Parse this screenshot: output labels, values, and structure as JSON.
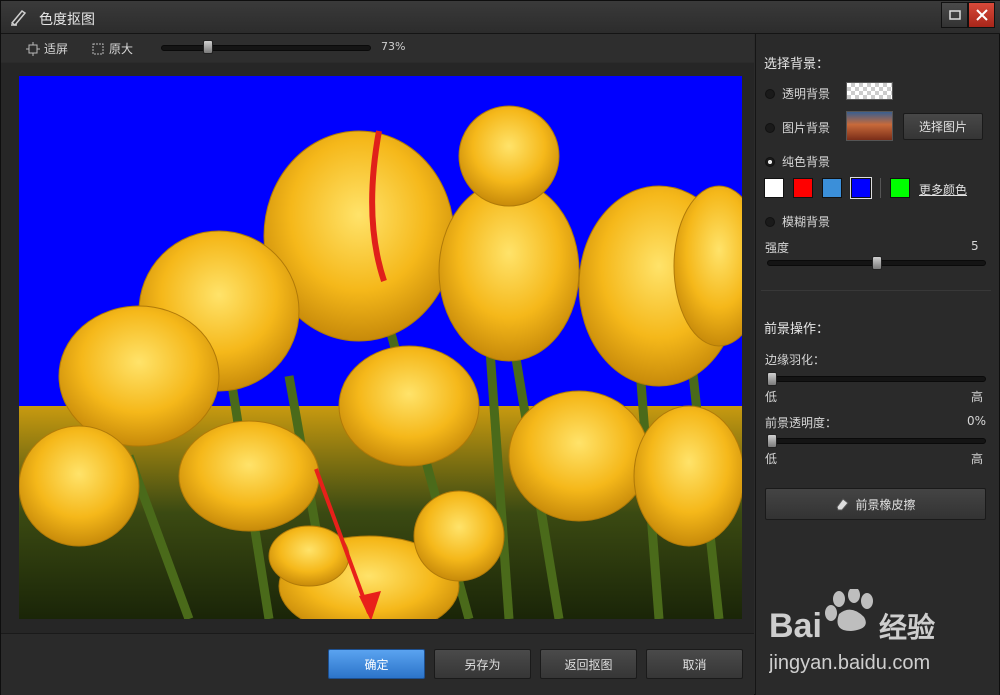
{
  "window": {
    "title": "色度抠图",
    "buttons": {
      "maximize_icon": "maximize-icon",
      "close_icon": "close-icon"
    }
  },
  "toolbar": {
    "fit_label": "适屏",
    "original_label": "原大",
    "zoom": {
      "value_label": "73%",
      "value": 0.73
    }
  },
  "canvas": {
    "background_color": "#0000ff",
    "subject": "yellow tulips photo with blue keyed background"
  },
  "footer": {
    "confirm": "确定",
    "save_as": "另存为",
    "back": "返回抠图",
    "cancel": "取消"
  },
  "panel": {
    "background": {
      "title": "选择背景：",
      "options": {
        "transparent": "透明背景",
        "image": "图片背景",
        "solid": "纯色背景",
        "blur": "模糊背景"
      },
      "selected": "solid",
      "select_image_button": "选择图片",
      "colors": [
        "#ffffff",
        "#ff0000",
        "#3b8fd9",
        "#0000ff",
        "#00ff00"
      ],
      "selected_color": "#0000ff",
      "more_colors": "更多颜色",
      "strength_label": "强度",
      "strength_value": "5",
      "strength_fraction": 0.5
    },
    "foreground": {
      "title": "前景操作：",
      "feather_label": "边缘羽化：",
      "feather_low": "低",
      "feather_high": "高",
      "feather_fraction": 0.0,
      "opacity_label": "前景透明度：",
      "opacity_value": "0%",
      "opacity_low": "低",
      "opacity_high": "高",
      "opacity_fraction": 0.0,
      "eraser_button": "前景橡皮擦"
    }
  },
  "watermark": {
    "logo_text": "Bai 经验",
    "url": "jingyan.baidu.com"
  }
}
